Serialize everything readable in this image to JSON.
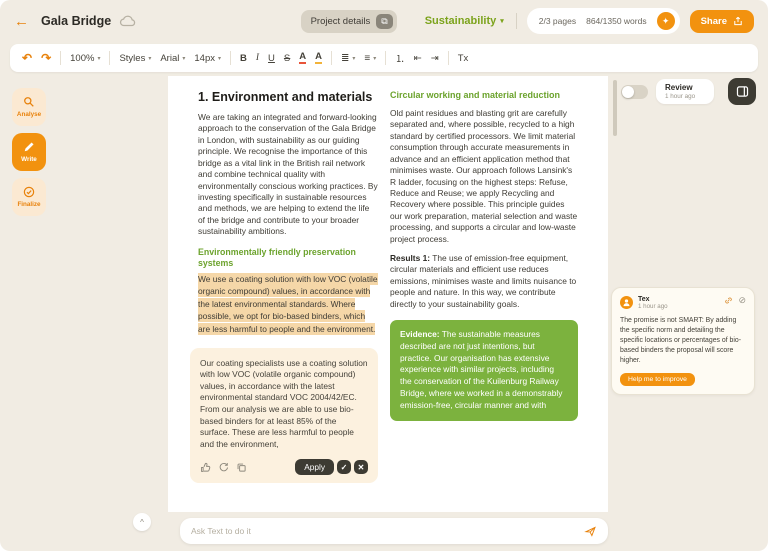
{
  "header": {
    "back_icon": "←",
    "title": "Gala Bridge",
    "project_details": "Project details",
    "project_details_icon": "⧉",
    "section": "Sustainability",
    "chevron": "▾",
    "pages": "2/3 pages",
    "words": "864/1350 words",
    "badge_icon": "✦",
    "share": "Share"
  },
  "toolbar": {
    "undo_icon": "↶",
    "redo_icon": "↷",
    "zoom": "100%",
    "styles": "Styles",
    "font": "Arial",
    "size": "14px",
    "chevron": "▾",
    "bold": "B",
    "italic": "I",
    "underline": "U",
    "strikethrough": "S",
    "font_color": "A",
    "highlight": "A",
    "list_icon": "≣",
    "align_icon": "≡",
    "numbered_icon": "⒈",
    "outdent_icon": "⇤",
    "indent_icon": "⇥",
    "clear_format": "Tx"
  },
  "sidebar": {
    "items": [
      {
        "label": "Analyse"
      },
      {
        "label": "Write"
      },
      {
        "label": "Finalize"
      }
    ]
  },
  "document": {
    "left": {
      "heading": "1. Environment and materials",
      "intro": "We are taking an integrated and forward-looking approach to the conservation of the Gala Bridge in London, with sustainability as our guiding principle. We recognise the importance of this bridge as a vital link in the British rail network and combine technical quality with environmentally conscious working practices. By investing specifically in sustainable resources and methods, we are helping to extend the life of the bridge and contribute to your broader sustainability ambitions.",
      "subheading": "Environmentally friendly preservation systems",
      "highlighted": "We use a coating solution with low VOC (volatile organic compound) values, in accordance with the latest environmental standards. Where possible, we opt for bio-based binders, which are less harmful to people and the environment.",
      "suggestion_text": "Our coating specialists use a coating solution with low VOC (volatile organic compound) values, in accordance with the latest environmental standard VOC 2004/42/EC. From our analysis we are able to use bio- based binders for at least 85% of the surface. These are less harmful to people and the environment,",
      "apply": "Apply",
      "accept_icon": "✓",
      "reject_icon": "✕"
    },
    "right": {
      "heading": "Circular working and material reduction",
      "body": "Old paint residues and blasting grit are carefully separated and, where possible, recycled to a high standard by certified processors. We limit material consumption through accurate measurements in advance and an efficient application method that minimises waste. Our approach follows Lansink's R ladder, focusing on the highest steps: Refuse, Reduce and Reuse; we apply Recycling and Recovery where possible. This principle guides our work preparation, material selection and waste processing, and supports a circular and low-waste project process.",
      "results_label": "Results 1:",
      "results_text": " The use of emission-free equipment, circular materials and efficient use reduces emissions, minimises waste and limits nuisance to people and nature. In this way, we contribute directly to your sustainability goals.",
      "evidence_label": "Evidence:",
      "evidence_text": " The sustainable measures described are not just intentions, but practice. Our organisation has extensive experience with similar projects, including the conservation of the Kuilenburg Railway Bridge, where we worked in a demonstrably emission-free, circular manner and with"
    }
  },
  "review_panel": {
    "review_label": "Review",
    "review_time": "1 hour ago",
    "resolve_icon": "⊘"
  },
  "comment": {
    "author": "Tex",
    "time": "1 hour ago",
    "body": "The promise is not SMART: By adding the specific norm and detailing the specific locations or percentages of bio-based binders the proposal will score higher.",
    "cta": "Help me to improve"
  },
  "chat": {
    "placeholder": "Ask Text to do it",
    "collapse_icon": "^"
  }
}
